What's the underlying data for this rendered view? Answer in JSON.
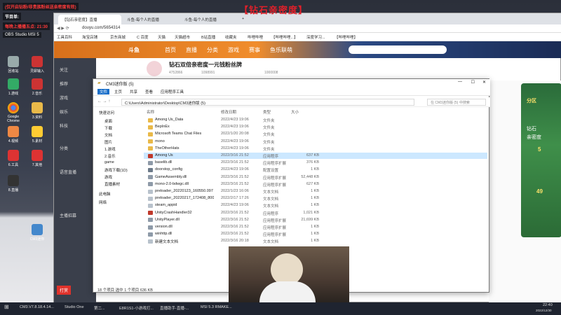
{
  "overlay": {
    "top_banner": "【钻石亲密度】",
    "lines": [
      "(仅开启钻粉/非贵族粉丝送亲密度有效)",
      "节目单:",
      "每晚上播播五点: 21:30"
    ],
    "obs_label": "OBS Studio MSI 5"
  },
  "desktop": {
    "icons": [
      "回收站",
      "灵犀输入",
      "Google Chrome",
      "1.游戏",
      "2.音乐",
      "3.资料",
      "4.视频",
      "5.素材",
      "6.工具",
      "7.其他",
      "8.直播",
      "CM3迷你"
    ]
  },
  "browser": {
    "tabs": [
      "【钻石亲密度】直播",
      "斗鱼-每个人的直播",
      "斗鱼-每个人的直播",
      "+"
    ],
    "url": "douyu.com/5654314",
    "bookmarks": [
      "工具百科",
      "淘宝店铺",
      "京东商城",
      "C 百度",
      "天猫",
      "天猫超市",
      "B站直播",
      "收藏夹",
      "哔哩哔哩",
      "【哔哩哔哩...】",
      "深度学习...",
      "【哔哩哔哩】"
    ]
  },
  "douyu": {
    "logo": "斗鱼",
    "nav": [
      "首页",
      "直播",
      "分类",
      "游戏",
      "赛事",
      "鱼乐联萌"
    ],
    "sidebar": [
      "关注",
      "推荐",
      "游戏",
      "娱乐",
      "科技",
      "分类",
      "语音直播",
      "主播招募",
      "打赏"
    ],
    "stream_title": "钻石双倍亲密度一元钱粉丝牌",
    "room_meta": [
      "4752866",
      "1098991",
      "1000008"
    ],
    "promo": [
      "分区",
      "钻石",
      "亲密度",
      "5",
      "49"
    ]
  },
  "explorer": {
    "title": "CM3迷你版 (5)",
    "ribbon": [
      "文件",
      "主页",
      "共享",
      "查看",
      "应用程序工具"
    ],
    "path": "C:\\Users\\Administrator\\Desktop\\CM3迷你版 (5)",
    "search_placeholder": "在 CM3迷你版 (5) 中搜索",
    "nav_items": [
      "快速访问",
      "桌面",
      "下载",
      "文档",
      "图片",
      "1.游戏",
      "2.音乐",
      "game",
      "游戏下载(1D)",
      "游戏",
      "直播素材",
      "此电脑",
      "网络"
    ],
    "columns": [
      "名称",
      "修改日期",
      "类型",
      "大小"
    ],
    "files": [
      {
        "name": "Among Us_Data",
        "date": "2022/4/23 19:06",
        "type": "文件夹",
        "size": "",
        "icon": "folder"
      },
      {
        "name": "BepInEx",
        "date": "2022/4/23 19:06",
        "type": "文件夹",
        "size": "",
        "icon": "folder"
      },
      {
        "name": "Microsoft Teams Chat Files",
        "date": "2022/1/20 20:08",
        "type": "文件夹",
        "size": "",
        "icon": "folder"
      },
      {
        "name": "mono",
        "date": "2022/4/23 19:06",
        "type": "文件夹",
        "size": "",
        "icon": "folder"
      },
      {
        "name": "TheOtherHats",
        "date": "2022/4/23 19:06",
        "type": "文件夹",
        "size": "",
        "icon": "folder"
      },
      {
        "name": "Among Us",
        "date": "2022/3/16 21:52",
        "type": "应用程序",
        "size": "637 KB",
        "icon": "app"
      },
      {
        "name": "baselib.dll",
        "date": "2022/3/16 21:52",
        "type": "应用程序扩展",
        "size": "376 KB",
        "icon": "dll"
      },
      {
        "name": "doorstop_config",
        "date": "2022/4/23 19:06",
        "type": "配置设置",
        "size": "1 KB",
        "icon": "cfg"
      },
      {
        "name": "GameAssembly.dll",
        "date": "2022/3/16 21:52",
        "type": "应用程序扩展",
        "size": "52,448 KB",
        "icon": "dll"
      },
      {
        "name": "mono-2.0-bdwgc.dll",
        "date": "2022/3/16 21:52",
        "type": "应用程序扩展",
        "size": "627 KB",
        "icon": "dll"
      },
      {
        "name": "preloader_20220123_160550.097",
        "date": "2022/1/23 16:06",
        "type": "文本文档",
        "size": "1 KB",
        "icon": "txt"
      },
      {
        "name": "preloader_20220217_172408_800",
        "date": "2022/2/17 17:26",
        "type": "文本文档",
        "size": "1 KB",
        "icon": "txt"
      },
      {
        "name": "steam_appid",
        "date": "2022/4/23 19:06",
        "type": "文本文档",
        "size": "1 KB",
        "icon": "txt"
      },
      {
        "name": "UnityCrashHandler32",
        "date": "2022/3/16 21:52",
        "type": "应用程序",
        "size": "1,021 KB",
        "icon": "app"
      },
      {
        "name": "UnityPlayer.dll",
        "date": "2022/3/16 21:52",
        "type": "应用程序扩展",
        "size": "21,699 KB",
        "icon": "dll"
      },
      {
        "name": "version.dll",
        "date": "2022/3/16 21:52",
        "type": "应用程序扩展",
        "size": "1 KB",
        "icon": "dll"
      },
      {
        "name": "winhttp.dll",
        "date": "2022/3/16 21:52",
        "type": "应用程序扩展",
        "size": "1 KB",
        "icon": "dll"
      },
      {
        "name": "新建文本文档",
        "date": "2022/3/16 20:18",
        "type": "文本文档",
        "size": "1 KB",
        "icon": "txt"
      }
    ],
    "status": "18 个项目    选中 1 个项目  636 KB"
  },
  "taskbar": {
    "items": [
      "CM3.V7.8.18.4.14...",
      "Studio One",
      "第二...",
      "E8R1S1-小游戏打...",
      "直播助手-直播-...",
      "MSI 5.3 RMAKE..."
    ],
    "time": "22:40",
    "date": "2022/12/30"
  },
  "colors": {
    "folder": "#e9b949",
    "app": "#c0392b",
    "dll": "#8e9aa8",
    "cfg": "#6c7a89",
    "txt": "#b8c2cc",
    "douyu": "#f08d2c"
  }
}
